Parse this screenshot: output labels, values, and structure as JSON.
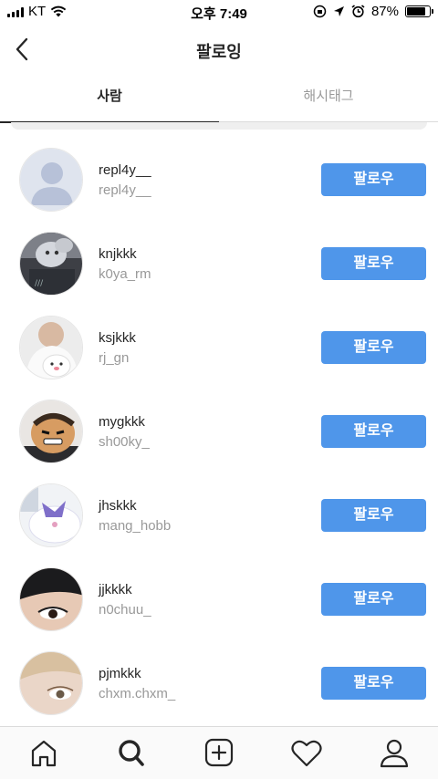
{
  "status_bar": {
    "carrier": "KT",
    "time": "오후 7:49",
    "battery_percent": "87%",
    "battery_level": 0.87
  },
  "header": {
    "title": "팔로잉"
  },
  "tabs": [
    {
      "label": "사람",
      "active": true
    },
    {
      "label": "해시태그",
      "active": false
    }
  ],
  "follow_label": "팔로우",
  "users": [
    {
      "name": "repl4y__",
      "subtitle": "repl4y__",
      "avatar": "default-avatar-icon"
    },
    {
      "name": "knjkkk",
      "subtitle": "k0ya_rm",
      "avatar": "koya-plush-photo"
    },
    {
      "name": "ksjkkk",
      "subtitle": "rj_gn",
      "avatar": "rj-plush-photo"
    },
    {
      "name": "mygkkk",
      "subtitle": "sh00ky_",
      "avatar": "shooky-plush-photo"
    },
    {
      "name": "jhskkk",
      "subtitle": "mang_hobb",
      "avatar": "mang-plush-photo"
    },
    {
      "name": "jjkkkk",
      "subtitle": "n0chuu_",
      "avatar": "eye-closeup-photo"
    },
    {
      "name": "pjmkkk",
      "subtitle": "chxm.chxm_",
      "avatar": "face-closeup-photo"
    }
  ],
  "bottom_nav": [
    "home-icon",
    "search-icon",
    "add-post-icon",
    "activity-heart-icon",
    "profile-icon"
  ],
  "colors": {
    "follow_button": "#4f96ea",
    "accent_text": "#262626",
    "secondary_text": "#999999"
  }
}
